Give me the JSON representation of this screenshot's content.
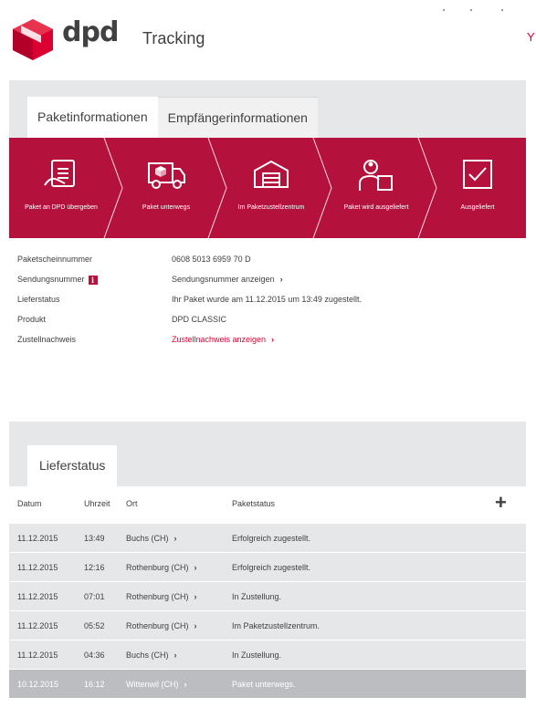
{
  "header": {
    "brand": "dpd",
    "title": "Tracking",
    "corner_glyph": "Y"
  },
  "colors": {
    "brand_red": "#dc0032",
    "strip_red": "#b5113d",
    "panel_gray": "#e6e7e8"
  },
  "info_tabs": [
    {
      "label": "Paketinformationen",
      "active": true
    },
    {
      "label": "Empfängerinformationen",
      "active": false
    }
  ],
  "progress_steps": [
    {
      "label": "Paket an DPD übergeben",
      "icon": "hand-package-icon"
    },
    {
      "label": "Paket unterwegs",
      "icon": "delivery-van-icon"
    },
    {
      "label": "Im Paketzustellzentrum",
      "icon": "depot-building-icon"
    },
    {
      "label": "Paket wird ausgeliefert",
      "icon": "courier-icon"
    },
    {
      "label": "Ausgeliefert",
      "icon": "checkmark-icon"
    }
  ],
  "info": {
    "parcel_number_label": "Paketscheinnummer",
    "parcel_number_value": "0608 5013 6959 70 D",
    "shipment_number_label": "Sendungsnummer",
    "shipment_number_badge": "i",
    "shipment_number_link": "Sendungsnummer anzeigen",
    "delivery_status_label": "Lieferstatus",
    "delivery_status_value": "Ihr Paket wurde am 11.12.2015 um 13:49 zugestellt.",
    "product_label": "Produkt",
    "product_value": "DPD CLASSIC",
    "proof_label": "Zustellnachweis",
    "proof_link": "Zustellnachweis anzeigen",
    "chevron": "›"
  },
  "status_tab": {
    "label": "Lieferstatus"
  },
  "status_table": {
    "headers": {
      "date": "Datum",
      "time": "Uhrzeit",
      "location": "Ort",
      "status": "Paketstatus"
    },
    "expand_symbol": "+",
    "rows": [
      {
        "date": "11.12.2015",
        "time": "13:49",
        "location": "Buchs (CH)",
        "status": "Erfolgreich zugestellt."
      },
      {
        "date": "11.12.2015",
        "time": "12:16",
        "location": "Rothenburg (CH)",
        "status": "Erfolgreich zugestellt."
      },
      {
        "date": "11.12.2015",
        "time": "07:01",
        "location": "Rothenburg (CH)",
        "status": "In Zustellung."
      },
      {
        "date": "11.12.2015",
        "time": "05:52",
        "location": "Rothenburg (CH)",
        "status": "Im Paketzustellzentrum."
      },
      {
        "date": "11.12.2015",
        "time": "04:36",
        "location": "Buchs (CH)",
        "status": "In Zustellung."
      },
      {
        "date": "10.12.2015",
        "time": "16:12",
        "location": "Wittenwil (CH)",
        "status": "Paket unterwegs."
      }
    ]
  }
}
